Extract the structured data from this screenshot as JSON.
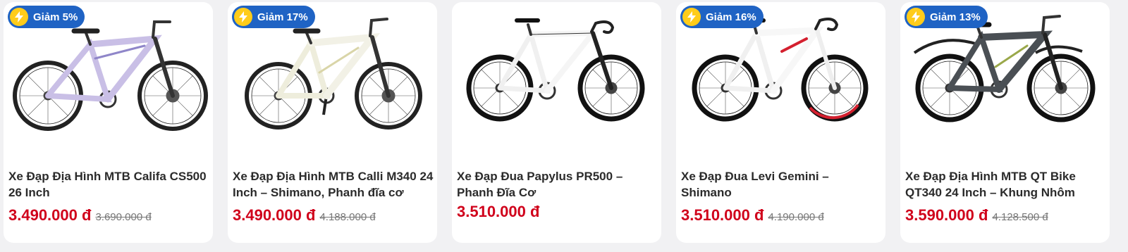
{
  "currency": "đ",
  "products": [
    {
      "badge": "Giảm 5%",
      "title": "Xe Đạp Địa Hình MTB Califa CS500 26 Inch",
      "price": "3.490.000 đ",
      "old_price": "3.690.000 đ",
      "frame_color": "#c9bfe6",
      "frame_accent": "#8f86c9",
      "icon": "mountain-bike-image"
    },
    {
      "badge": "Giảm 17%",
      "title": "Xe Đạp Địa Hình MTB Calli M340 24 Inch – Shimano, Phanh đĩa cơ",
      "price": "3.490.000 đ",
      "old_price": "4.188.000 đ",
      "frame_color": "#f2f1e6",
      "frame_accent": "#d9d5a8",
      "icon": "mountain-bike-image"
    },
    {
      "badge": "",
      "title": "Xe Đạp Đua Papylus PR500 – Phanh Đĩa Cơ",
      "price": "3.510.000 đ",
      "old_price": "",
      "frame_color": "#f5f5f5",
      "frame_accent": "#333333",
      "icon": "road-bike-image"
    },
    {
      "badge": "Giảm 16%",
      "title": "Xe Đạp Đua Levi Gemini – Shimano",
      "price": "3.510.000 đ",
      "old_price": "4.190.000 đ",
      "frame_color": "#f7f7f7",
      "frame_accent": "#d4202f",
      "icon": "road-bike-image"
    },
    {
      "badge": "Giảm 13%",
      "title": "Xe Đạp Địa Hình MTB QT Bike QT340 24 Inch – Khung Nhôm",
      "price": "3.590.000 đ",
      "old_price": "4.128.500 đ",
      "frame_color": "#4a4f54",
      "frame_accent": "#9aa84a",
      "icon": "mountain-bike-image"
    }
  ]
}
